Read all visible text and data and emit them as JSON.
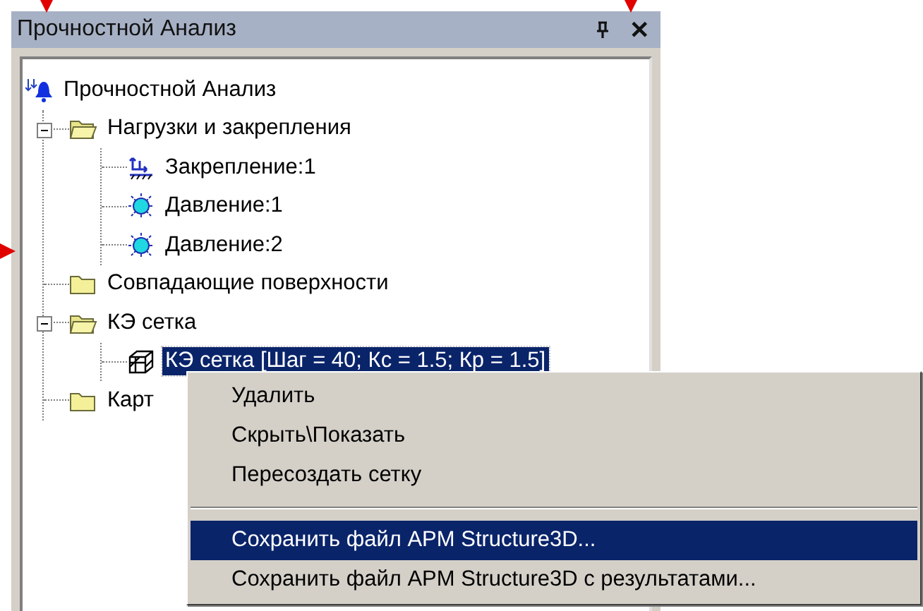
{
  "panel": {
    "title": "Прочностной Анализ",
    "close": "✕"
  },
  "tree": [
    {
      "label": "Прочностной Анализ",
      "kind": "root",
      "selected": false,
      "children": [
        {
          "label": "Нагрузки и закрепления",
          "kind": "folder",
          "expanded": true,
          "selected": false,
          "children": [
            {
              "label": "Закрепление:1",
              "kind": "fixture",
              "selected": false
            },
            {
              "label": "Давление:1",
              "kind": "pressure",
              "selected": false
            },
            {
              "label": "Давление:2",
              "kind": "pressure",
              "selected": false
            }
          ]
        },
        {
          "label": "Совпадающие поверхности",
          "kind": "folder",
          "expanded": false,
          "selected": false
        },
        {
          "label": "КЭ сетка",
          "kind": "folder",
          "expanded": true,
          "selected": false,
          "children": [
            {
              "label": "КЭ сетка [Шаг = 40; Кс = 1.5; Кр = 1.5]",
              "kind": "mesh",
              "selected": true
            }
          ]
        },
        {
          "label": "Карт",
          "kind": "folder",
          "expanded": false,
          "selected": false
        }
      ]
    }
  ],
  "context_menu": [
    {
      "kind": "item",
      "label": "Удалить",
      "selected": false
    },
    {
      "kind": "item",
      "label": "Скрыть\\Показать",
      "selected": false
    },
    {
      "kind": "item",
      "label": "Пересоздать сетку",
      "selected": false
    },
    {
      "kind": "separator"
    },
    {
      "kind": "item",
      "label": "Сохранить файл APM Structure3D...",
      "selected": true
    },
    {
      "kind": "item",
      "label": "Сохранить файл APM Structure3D с результатами...",
      "selected": false
    }
  ]
}
